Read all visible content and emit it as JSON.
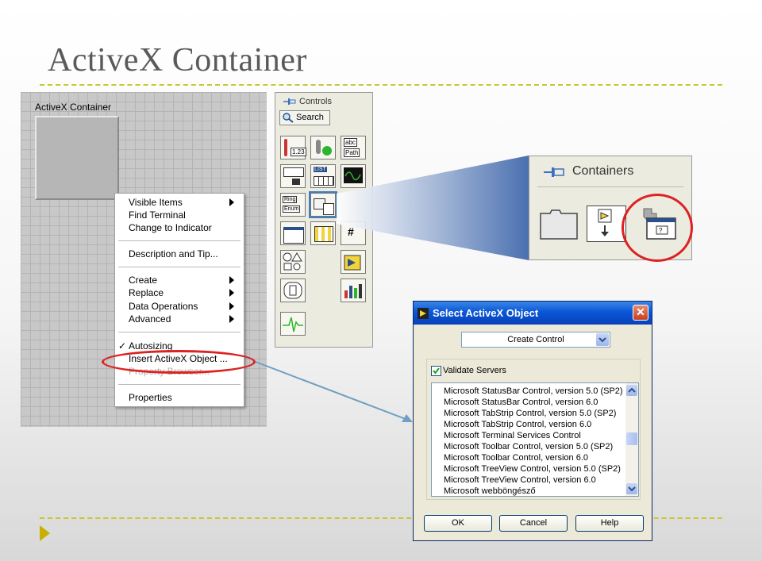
{
  "slide": {
    "title": "ActiveX Container"
  },
  "front_panel": {
    "container_label": "ActiveX Container"
  },
  "context_menu": {
    "items": [
      {
        "label": "Visible Items",
        "submenu": true
      },
      {
        "label": "Find Terminal"
      },
      {
        "label": "Change to Indicator"
      },
      {
        "label": "Description and Tip..."
      },
      {
        "label": "Create",
        "submenu": true
      },
      {
        "label": "Replace",
        "submenu": true
      },
      {
        "label": "Data Operations",
        "submenu": true
      },
      {
        "label": "Advanced",
        "submenu": true
      },
      {
        "label": "Autosizing",
        "checked": true
      },
      {
        "label": "Insert ActiveX Object ..."
      },
      {
        "label": "Property Browser...",
        "disabled": true
      },
      {
        "label": "Properties"
      }
    ],
    "check_mark": "✓"
  },
  "controls_palette": {
    "title": "Controls",
    "search_label": "Search",
    "icon_labels": {
      "numeric": "1.23",
      "string": "abc",
      "path": "Path",
      "list": "LIST",
      "ring": "Ring",
      "enum": "Enum",
      "hash": "#"
    }
  },
  "containers_zoom": {
    "title": "Containers"
  },
  "dialog": {
    "title": "Select ActiveX Object",
    "close_glyph": "✕",
    "combo_value": "Create Control",
    "validate_label": "Validate Servers",
    "validate_checked": true,
    "list_items": [
      "Microsoft StatusBar Control, version 5.0 (SP2)",
      "Microsoft StatusBar Control, version 6.0",
      "Microsoft TabStrip Control, version 5.0 (SP2)",
      "Microsoft TabStrip Control, version 6.0",
      "Microsoft Terminal Services Control",
      "Microsoft Toolbar Control, version 5.0 (SP2)",
      "Microsoft Toolbar Control, version 6.0",
      "Microsoft TreeView Control, version 5.0 (SP2)",
      "Microsoft TreeView Control, version 6.0",
      "Microsoft webböngésző"
    ],
    "buttons": {
      "ok": "OK",
      "cancel": "Cancel",
      "help": "Help"
    }
  },
  "colors": {
    "accent_dash": "#c8c830",
    "highlight_red": "#d22222",
    "arrow_blue": "#6ea0c0",
    "titlebar_blue": "#0a57d8"
  }
}
